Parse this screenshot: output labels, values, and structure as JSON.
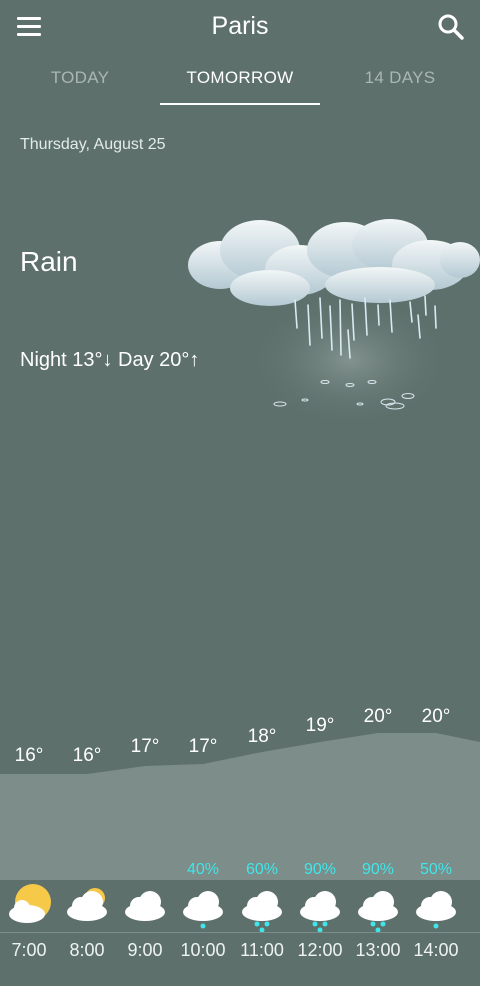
{
  "header": {
    "city": "Paris",
    "menu_icon": "hamburger-menu-icon",
    "search_icon": "search-icon"
  },
  "tabs": [
    {
      "label": "TODAY",
      "active": false
    },
    {
      "label": "TOMORROW",
      "active": true
    },
    {
      "label": "14 DAYS",
      "active": false
    }
  ],
  "forecast": {
    "date": "Thursday, August 25",
    "condition": "Rain",
    "night_day": "Night 13°↓ Day 20°↑",
    "icon": "rain-cloud-icon"
  },
  "hourly": [
    {
      "time": "7:00",
      "temp": "16°",
      "precip": "",
      "icon": "partly-sunny-icon"
    },
    {
      "time": "8:00",
      "temp": "16°",
      "precip": "",
      "icon": "partly-cloudy-icon"
    },
    {
      "time": "9:00",
      "temp": "17°",
      "precip": "",
      "icon": "cloud-icon"
    },
    {
      "time": "10:00",
      "temp": "17°",
      "precip": "40%",
      "icon": "light-rain-icon"
    },
    {
      "time": "11:00",
      "temp": "18°",
      "precip": "60%",
      "icon": "rain-icon"
    },
    {
      "time": "12:00",
      "temp": "19°",
      "precip": "90%",
      "icon": "rain-icon"
    },
    {
      "time": "13:00",
      "temp": "20°",
      "precip": "90%",
      "icon": "rain-icon"
    },
    {
      "time": "14:00",
      "temp": "20°",
      "precip": "50%",
      "icon": "light-rain-icon"
    }
  ],
  "colors": {
    "background": "#5e706c",
    "precip": "#3fe6ea",
    "graph_fill": "#7d8d89"
  }
}
